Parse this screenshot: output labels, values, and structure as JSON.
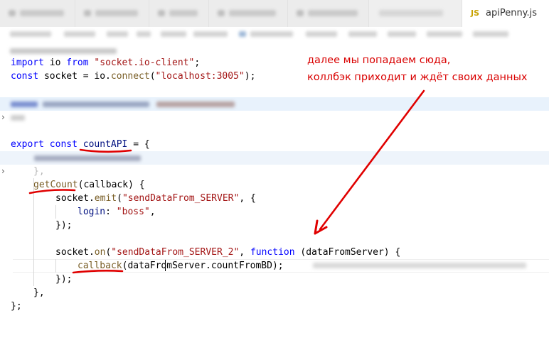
{
  "tabs": [
    {
      "label": "",
      "blurred": true
    },
    {
      "label": "",
      "blurred": true
    },
    {
      "label": "",
      "blurred": true
    },
    {
      "label": "",
      "blurred": true
    },
    {
      "label": "",
      "blurred": true
    },
    {
      "label": "apiPenny.js",
      "icon": "JS",
      "active": true
    }
  ],
  "code": {
    "import_kw": "import",
    "import_name": " io ",
    "from_kw": "from",
    "import_str": "\"socket.io-client\"",
    "semi": ";",
    "const_kw": "const",
    "socket_decl": " socket = io.",
    "connect_fn": "connect",
    "paren_open": "(",
    "connect_str": "\"localhost:3005\"",
    "paren_close_semi": ");",
    "export_kw": "export",
    "const_kw2": "const",
    "count_api": "countAPI",
    "count_api_rest": " = {",
    "collapsed_marker": "},",
    "get_count_fn": "getCount",
    "get_count_rest": "(callback) {",
    "emit_prefix": "socket.",
    "emit_fn": "emit",
    "emit_open": "(",
    "emit_str": "\"sendDataFrom_SERVER\"",
    "emit_rest": ", {",
    "login_key": "login",
    "login_colon": ": ",
    "login_val": "\"boss\"",
    "login_comma": ",",
    "close_obj": "});",
    "on_prefix": "socket.",
    "on_fn": "on",
    "on_open": "(",
    "on_str": "\"sendDataFrom_SERVER_2\"",
    "on_comma": ", ",
    "function_kw": "function",
    "on_rest": " (dataFromServer) {",
    "callback_fn": "callback",
    "callback_arg_a": "(dataFr",
    "callback_arg_b": "omServer.countFromBD",
    "callback_close": ");",
    "close_on": "});",
    "close_getcount": "},",
    "close_export": "};"
  },
  "annotation": {
    "line1": "далее мы попадаем сюда,",
    "line2": "коллбэк приходит и ждёт своих данных"
  },
  "colors": {
    "keyword": "#0000ff",
    "string": "#a31515",
    "function": "#795e26",
    "property": "#001080",
    "annotation": "#d90000",
    "highlight_line": "#e8f2fc",
    "js_icon": "#c8a200"
  }
}
